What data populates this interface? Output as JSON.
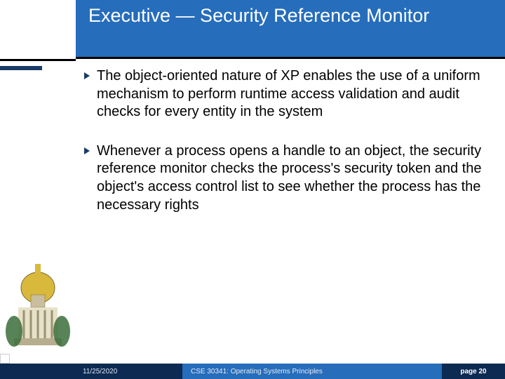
{
  "title": "Executive — Security Reference Monitor",
  "bullets": [
    "The object-oriented nature of XP enables the use of a uniform mechanism to perform runtime access validation and audit checks for every entity in the system",
    "Whenever a process opens a handle to an object, the security reference monitor checks the process's security token and the object's access control list to see whether the process has the necessary rights"
  ],
  "footer": {
    "date": "11/25/2020",
    "course": "CSE 30341: Operating Systems Principles",
    "page_label": "page 20"
  },
  "colors": {
    "title_bg": "#266dbb",
    "dark": "#0c2a52"
  }
}
